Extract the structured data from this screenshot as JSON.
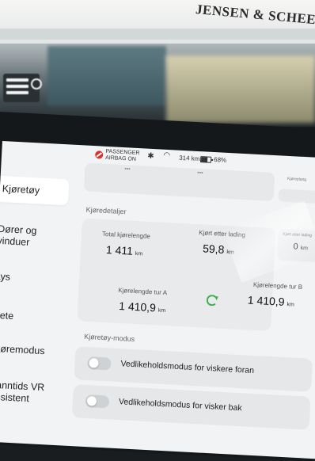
{
  "store": {
    "sign_text": "JENSEN & SCHEELE"
  },
  "status": {
    "passenger_airbag": "PASSENGER",
    "airbag_state": "AIRBAG ON",
    "range": "314 km",
    "battery": "68%"
  },
  "sidebar": {
    "items": [
      {
        "label": "Kjøretøy",
        "active": true
      },
      {
        "label_line1": "Dører og",
        "label_line2": "vinduer"
      },
      {
        "label": "Lys"
      },
      {
        "label": "Sete"
      },
      {
        "label": "Kjøremodus"
      },
      {
        "label_line1": "Sanntids VR",
        "label_line2": "Assistent"
      }
    ]
  },
  "top_card": {
    "side_label": "Kjøreplang"
  },
  "driving_details": {
    "section_title": "Kjøredetaljer",
    "total_label": "Total kjørelengde",
    "total_value": "1 411",
    "total_unit": "km",
    "since_charge_label": "Kjørt etter lading",
    "since_charge_value": "59,8",
    "since_charge_unit": "km",
    "trip_a_label": "Kjørelengde tur A",
    "trip_a_value": "1 410,9",
    "trip_a_unit": "km",
    "trip_b_label": "Kjørelengde tur B",
    "trip_b_value": "1 410,9",
    "trip_b_unit": "km",
    "side_label": "Kjørt etter lading",
    "side_value": "0",
    "side_unit": "km"
  },
  "vehicle_mode": {
    "section_title": "Kjøretøy-modus",
    "toggle1_label": "Vedlikeholdsmodus for viskere foran",
    "toggle2_label": "Vedlikeholdsmodus for visker bak"
  },
  "colors": {
    "accent_green": "#3fae54",
    "alert_red": "#d9322b"
  }
}
